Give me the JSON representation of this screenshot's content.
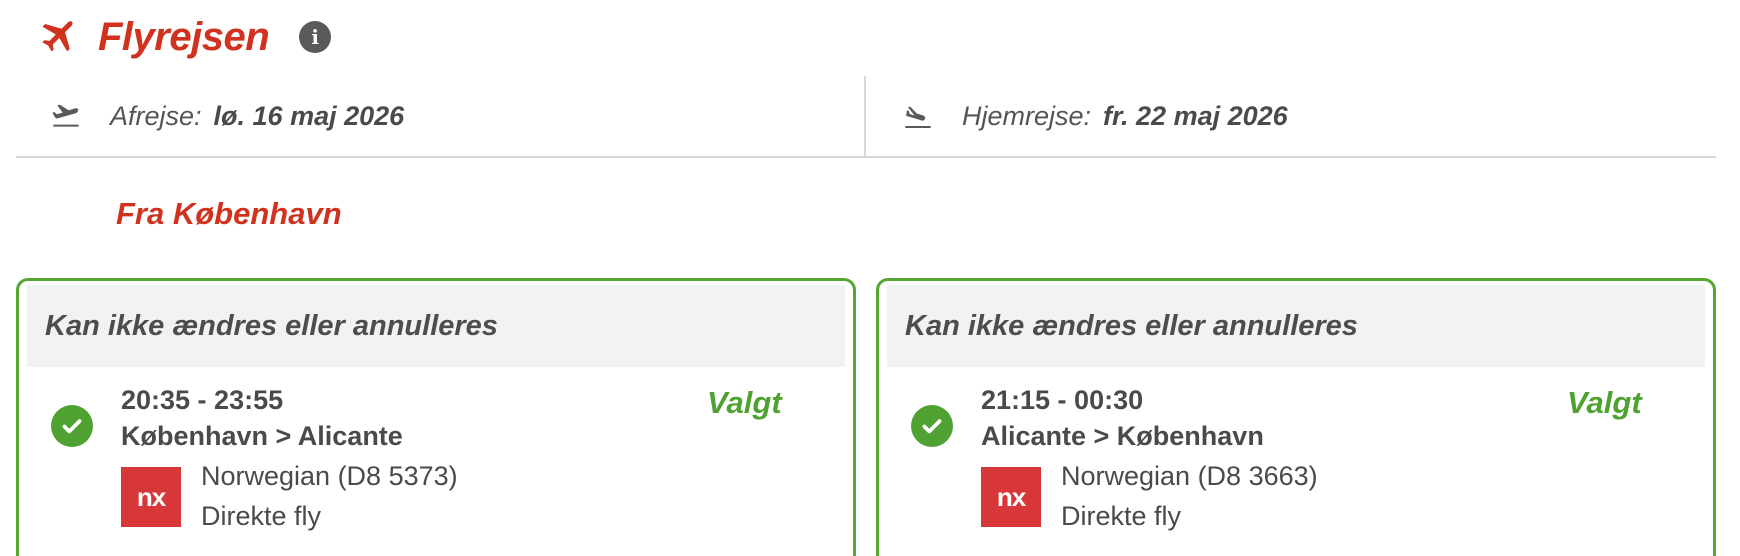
{
  "header": {
    "title": "Flyrejsen",
    "plane_icon": "airplane-icon",
    "info_icon": "info-icon",
    "info_glyph": "i"
  },
  "dates": {
    "departure_label": "Afrejse:",
    "departure_value": "lø. 16 maj 2026",
    "return_label": "Hjemrejse:",
    "return_value": "fr. 22 maj 2026"
  },
  "from_label": "Fra København",
  "flights": [
    {
      "header": "Kan ikke ændres eller annulleres",
      "time": "20:35 - 23:55",
      "route": "København > Alicante",
      "airline": "Norwegian (D8 5373)",
      "stops": "Direkte fly",
      "status": "Valgt",
      "logo_text": "nx"
    },
    {
      "header": "Kan ikke ændres eller annulleres",
      "time": "21:15 - 00:30",
      "route": "Alicante > København",
      "airline": "Norwegian (D8 3663)",
      "stops": "Direkte fly",
      "status": "Valgt",
      "logo_text": "nx"
    }
  ],
  "colors": {
    "brand_red": "#d0321e",
    "selected_green": "#4fa232",
    "norwegian_red": "#d8373a"
  }
}
